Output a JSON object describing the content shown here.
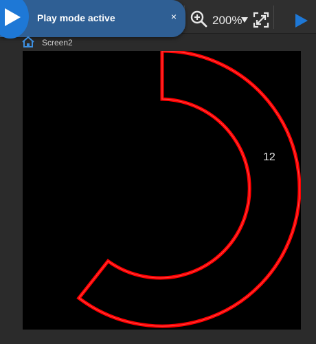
{
  "toast": {
    "message": "Play mode active",
    "close_label": "×"
  },
  "toolbar": {
    "zoom_level": "200%"
  },
  "breadcrumb": {
    "screen_name": "Screen2"
  },
  "canvas": {
    "gauge_value": "12"
  },
  "colors": {
    "accent": "#1e78d6",
    "gauge": "#ff0000",
    "toolbar_bg": "#2f2f2f",
    "canvas_bg": "#000000"
  },
  "icons": {
    "zoom": "zoom-in-icon",
    "zoom_menu": "caret-down-icon",
    "fit": "fit-screen-icon",
    "run": "play-icon",
    "home": "home-icon"
  }
}
